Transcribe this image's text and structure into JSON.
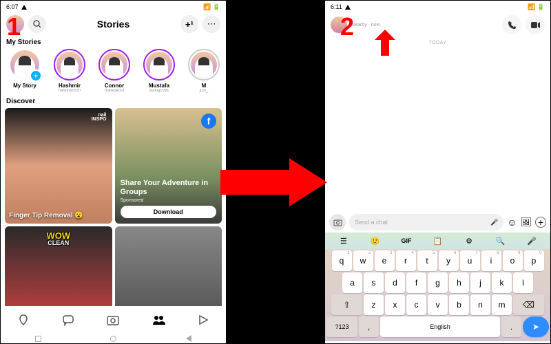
{
  "step1_label": "1",
  "step2_label": "2",
  "phone1": {
    "status": {
      "time": "6:07",
      "icons": "▲ ⚠"
    },
    "header": {
      "title": "Stories",
      "search_icon": "search",
      "add_icon": "+",
      "more_icon": "⋯"
    },
    "my_stories_title": "My Stories",
    "stories": [
      {
        "name": "My Story",
        "user": ""
      },
      {
        "name": "Hashmir",
        "user": "hashmirrr20"
      },
      {
        "name": "Connor",
        "user": "thatedeboi"
      },
      {
        "name": "Mustafa",
        "user": "staflaj1991"
      },
      {
        "name": "M",
        "user": "just_"
      }
    ],
    "discover_title": "Discover",
    "tiles": {
      "t1": {
        "logo_top": "nail",
        "logo_sub": "INSPO",
        "caption": "Finger Tip Removal 😮"
      },
      "t2": {
        "title": "Share Your Adventure in Groups",
        "sub": "Sponsored",
        "button": "Download"
      },
      "t3": {
        "wow_top": "WOW",
        "wow_sub": "CLEAN"
      }
    },
    "nav": [
      "map",
      "chat",
      "camera",
      "people",
      "play"
    ]
  },
  "phone2": {
    "status": {
      "time": "6:11",
      "icons": "▲ ⚠"
    },
    "header": {
      "name": "",
      "sub": "Nearby · now"
    },
    "today": "TODAY",
    "input": {
      "placeholder": "Send a chat"
    },
    "toolbar": [
      "☰",
      "🙂",
      "GIF",
      "📋",
      "⚙",
      "🔍",
      "🎤"
    ],
    "keyboard": {
      "row1": [
        [
          "q",
          "1"
        ],
        [
          "w",
          "2"
        ],
        [
          "e",
          "3"
        ],
        [
          "r",
          "4"
        ],
        [
          "t",
          "5"
        ],
        [
          "y",
          "6"
        ],
        [
          "u",
          "7"
        ],
        [
          "i",
          "8"
        ],
        [
          "o",
          "9"
        ],
        [
          "p",
          "0"
        ]
      ],
      "row2": [
        "a",
        "s",
        "d",
        "f",
        "g",
        "h",
        "j",
        "k",
        "l"
      ],
      "row3": [
        "z",
        "x",
        "c",
        "v",
        "b",
        "n",
        "m"
      ],
      "shift": "⇧",
      "bksp": "⌫",
      "sym": "?123",
      "comma": ",",
      "space": "English",
      "period": ".",
      "send": "➤"
    }
  }
}
